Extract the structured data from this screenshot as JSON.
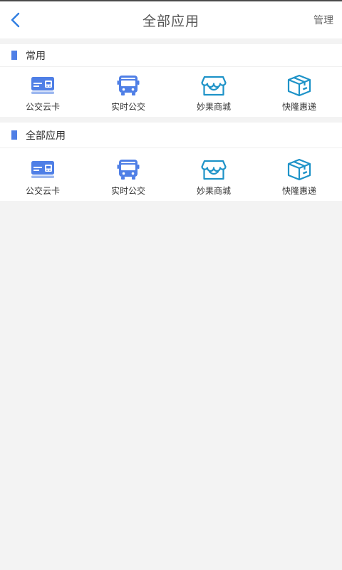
{
  "header": {
    "title": "全部应用",
    "manage_label": "管理",
    "back_icon": "chevron-left-icon"
  },
  "colors": {
    "accent": "#4f7fe6",
    "teal": "#1e93c8",
    "background": "#f3f3f3"
  },
  "sections": [
    {
      "title": "常用",
      "apps": [
        {
          "label": "公交云卡",
          "icon": "bus-card-icon"
        },
        {
          "label": "实时公交",
          "icon": "bus-icon"
        },
        {
          "label": "妙果商城",
          "icon": "store-icon"
        },
        {
          "label": "快隆惠递",
          "icon": "package-icon"
        }
      ]
    },
    {
      "title": "全部应用",
      "apps": [
        {
          "label": "公交云卡",
          "icon": "bus-card-icon"
        },
        {
          "label": "实时公交",
          "icon": "bus-icon"
        },
        {
          "label": "妙果商城",
          "icon": "store-icon"
        },
        {
          "label": "快隆惠递",
          "icon": "package-icon"
        }
      ]
    }
  ]
}
